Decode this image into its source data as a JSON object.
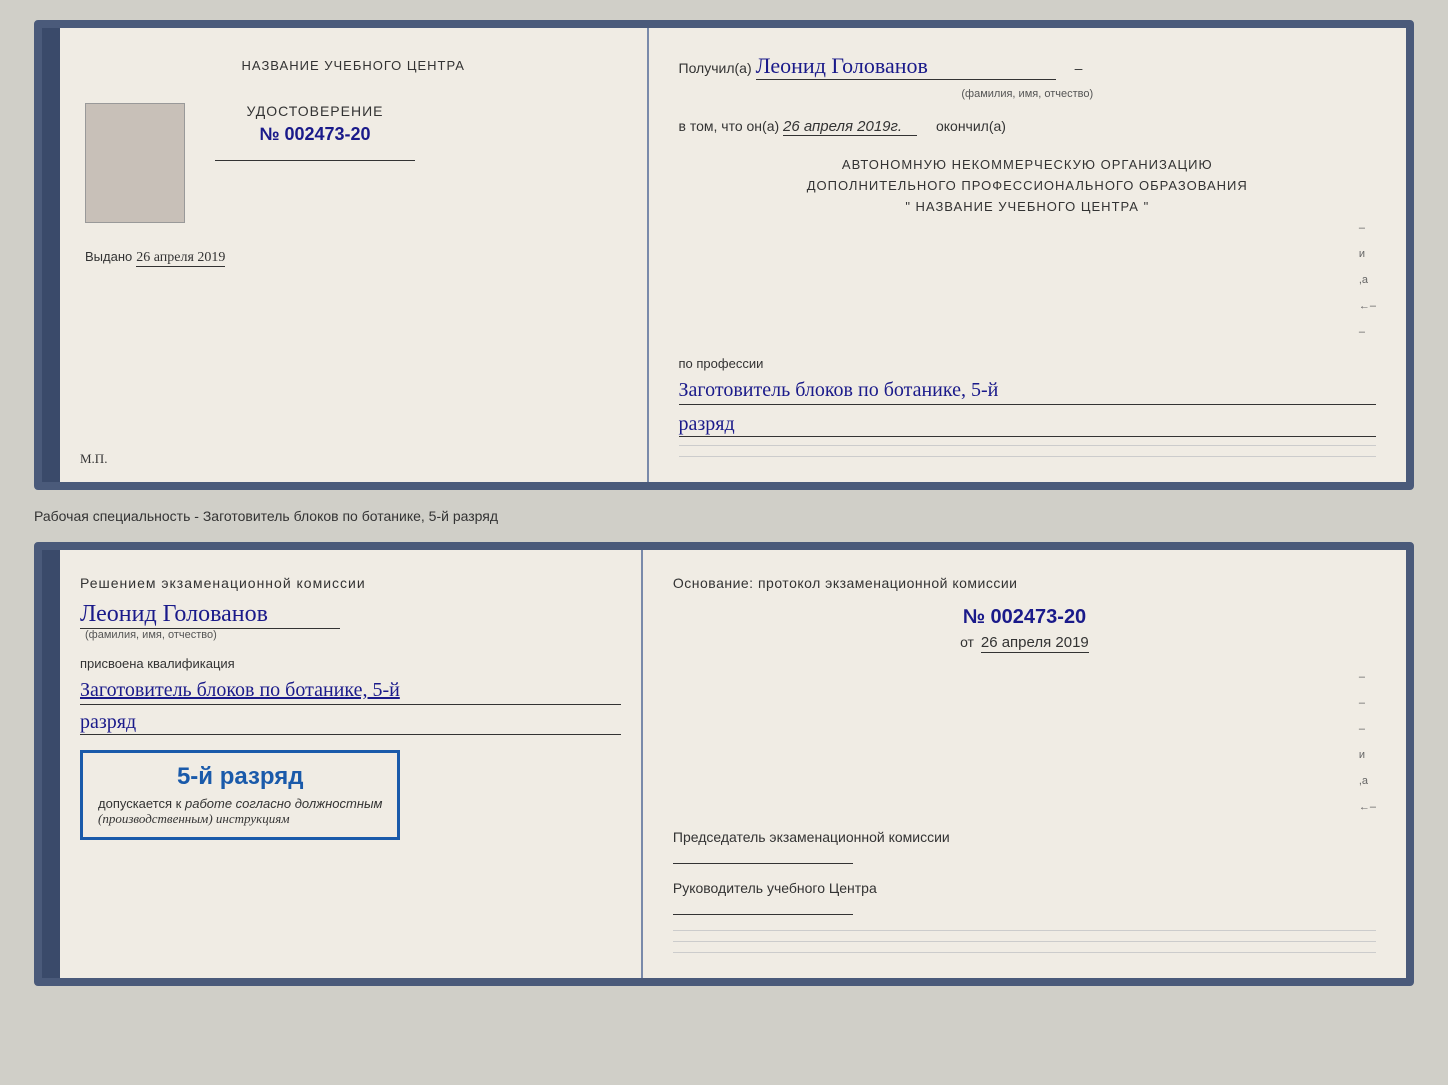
{
  "doc1": {
    "left": {
      "training_center_label": "НАЗВАНИЕ УЧЕБНОГО ЦЕНТРА",
      "cert_label": "УДОСТОВЕРЕНИЕ",
      "cert_number": "№ 002473-20",
      "issued_label": "Выдано",
      "issued_date": "26 апреля 2019",
      "mp_label": "М.П."
    },
    "right": {
      "received_prefix": "Получил(а)",
      "received_name": "Леонид Голованов",
      "fio_sub": "(фамилия, имя, отчество)",
      "date_prefix": "в том, что он(а)",
      "date_value": "26 апреля 2019г.",
      "completed_label": "окончил(а)",
      "org_line1": "АВТОНОМНУЮ НЕКОММЕРЧЕСКУЮ ОРГАНИЗАЦИЮ",
      "org_line2": "ДОПОЛНИТЕЛЬНОГО ПРОФЕССИОНАЛЬНОГО ОБРАЗОВАНИЯ",
      "org_line3": "\"  НАЗВАНИЕ УЧЕБНОГО ЦЕНТРА  \"",
      "profession_label": "по профессии",
      "profession_value": "Заготовитель блоков по ботанике, 5-й",
      "razryad_value": "разряд"
    }
  },
  "separator": {
    "label": "Рабочая специальность - Заготовитель блоков по ботанике, 5-й разряд"
  },
  "doc2": {
    "left": {
      "decision_label": "Решением экзаменационной комиссии",
      "person_name": "Леонид Голованов",
      "fio_sub": "(фамилия, имя, отчество)",
      "qualification_label": "присвоена квалификация",
      "qualification_value": "Заготовитель блоков по ботанике, 5-й",
      "razryad_value": "разряд",
      "stamp_main": "5-й разряд",
      "stamp_allowed": "допускается к",
      "stamp_work": "работе согласно должностным",
      "stamp_instructions": "(производственным) инструкциям"
    },
    "right": {
      "basis_label": "Основание: протокол экзаменационной комиссии",
      "protocol_number": "№  002473-20",
      "date_prefix": "от",
      "date_value": "26 апреля 2019",
      "chairman_label": "Председатель экзаменационной комиссии",
      "director_label": "Руководитель учебного Центра"
    }
  }
}
